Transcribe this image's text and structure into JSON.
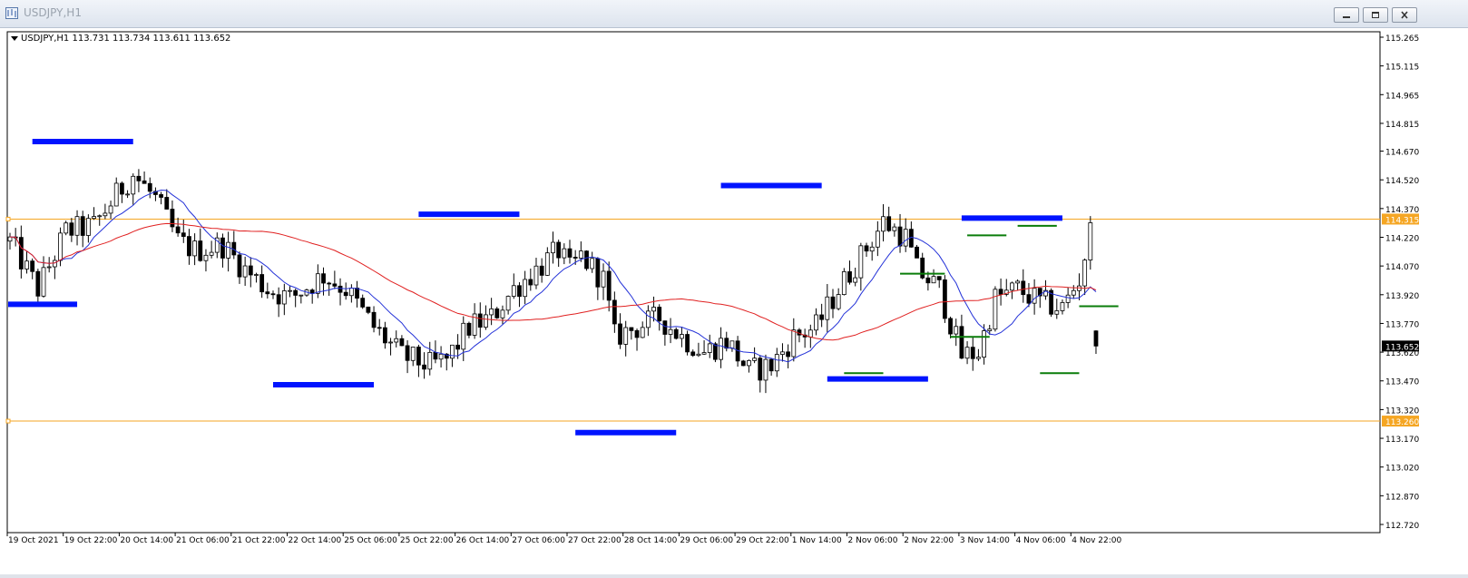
{
  "window": {
    "title": "USDJPY,H1",
    "controls": [
      "minimize-icon",
      "restore-icon",
      "close-icon"
    ]
  },
  "chart_info": {
    "label": "USDJPY,H1  113.731 113.734 113.611 113.652"
  },
  "chart_data": {
    "type": "candlestick",
    "symbol": "USDJPY",
    "timeframe": "H1",
    "ohlc": {
      "open": 113.731,
      "high": 113.734,
      "low": 113.611,
      "close": 113.652
    },
    "ylim": [
      112.72,
      115.265
    ],
    "y_ticks": [
      "115.265",
      "115.115",
      "114.965",
      "114.815",
      "114.670",
      "114.520",
      "114.370",
      "114.220",
      "114.070",
      "113.920",
      "113.770",
      "113.620",
      "113.470",
      "113.320",
      "113.170",
      "113.020",
      "112.870",
      "112.720"
    ],
    "x_ticks": [
      "19 Oct 2021",
      "19 Oct 22:00",
      "20 Oct 14:00",
      "21 Oct 06:00",
      "21 Oct 22:00",
      "22 Oct 14:00",
      "25 Oct 06:00",
      "25 Oct 22:00",
      "26 Oct 14:00",
      "27 Oct 06:00",
      "27 Oct 22:00",
      "28 Oct 14:00",
      "29 Oct 06:00",
      "29 Oct 22:00",
      "1 Nov 14:00",
      "2 Nov 06:00",
      "2 Nov 22:00",
      "3 Nov 14:00",
      "4 Nov 06:00",
      "4 Nov 22:00"
    ],
    "bar_count": 195,
    "anchors": [
      [
        0,
        114.2
      ],
      [
        5,
        113.95
      ],
      [
        10,
        114.25
      ],
      [
        15,
        114.28
      ],
      [
        20,
        114.48
      ],
      [
        22,
        114.55
      ],
      [
        26,
        114.42
      ],
      [
        30,
        114.2
      ],
      [
        33,
        114.15
      ],
      [
        38,
        114.18
      ],
      [
        42,
        114.05
      ],
      [
        46,
        113.95
      ],
      [
        50,
        113.9
      ],
      [
        56,
        114.02
      ],
      [
        60,
        113.95
      ],
      [
        65,
        113.75
      ],
      [
        70,
        113.6
      ],
      [
        75,
        113.55
      ],
      [
        78,
        113.58
      ],
      [
        82,
        113.75
      ],
      [
        86,
        113.8
      ],
      [
        90,
        113.95
      ],
      [
        94,
        114.05
      ],
      [
        98,
        114.15
      ],
      [
        100,
        114.05
      ],
      [
        102,
        114.12
      ],
      [
        106,
        114.0
      ],
      [
        108,
        113.7
      ],
      [
        112,
        113.75
      ],
      [
        116,
        113.8
      ],
      [
        120,
        113.7
      ],
      [
        124,
        113.62
      ],
      [
        128,
        113.68
      ],
      [
        132,
        113.52
      ],
      [
        136,
        113.55
      ],
      [
        140,
        113.7
      ],
      [
        144,
        113.75
      ],
      [
        148,
        113.95
      ],
      [
        152,
        114.12
      ],
      [
        156,
        114.3
      ],
      [
        160,
        114.22
      ],
      [
        162,
        114.05
      ],
      [
        166,
        113.95
      ],
      [
        170,
        113.6
      ],
      [
        173,
        113.62
      ],
      [
        176,
        113.9
      ],
      [
        180,
        113.95
      ],
      [
        184,
        113.88
      ],
      [
        188,
        113.85
      ],
      [
        191,
        114.0
      ],
      [
        193,
        114.25
      ],
      [
        196,
        114.05
      ],
      [
        198,
        114.0
      ],
      [
        200,
        113.85
      ],
      [
        202,
        113.62
      ]
    ],
    "horizontal_levels": [
      {
        "value": 114.315,
        "label": "114.315",
        "color": "#f5a623"
      },
      {
        "value": 113.26,
        "label": "113.260",
        "color": "#f5a623"
      }
    ],
    "current_price": {
      "value": 113.652,
      "label": "113.652"
    },
    "series": [
      {
        "type": "moving-average",
        "color": "#2432d8"
      },
      {
        "type": "moving-average",
        "color": "#e02020"
      }
    ],
    "levels": [
      {
        "bar": [
          4,
          22
        ],
        "value": 114.72,
        "color": "#0014ff"
      },
      {
        "bar": [
          -2,
          12
        ],
        "value": 113.87,
        "color": "#0014ff"
      },
      {
        "bar": [
          47,
          65
        ],
        "value": 113.45,
        "color": "#0014ff"
      },
      {
        "bar": [
          73,
          91
        ],
        "value": 114.34,
        "color": "#0014ff"
      },
      {
        "bar": [
          101,
          119
        ],
        "value": 113.2,
        "color": "#0014ff"
      },
      {
        "bar": [
          127,
          145
        ],
        "value": 114.49,
        "color": "#0014ff"
      },
      {
        "bar": [
          146,
          164
        ],
        "value": 113.48,
        "color": "#0014ff"
      },
      {
        "bar": [
          170,
          188
        ],
        "value": 114.32,
        "color": "#0014ff"
      },
      {
        "bar": [
          149,
          156
        ],
        "value": 113.51,
        "color": "#0a7d0a"
      },
      {
        "bar": [
          159,
          167
        ],
        "value": 114.03,
        "color": "#0a7d0a"
      },
      {
        "bar": [
          168,
          175
        ],
        "value": 113.7,
        "color": "#0a7d0a"
      },
      {
        "bar": [
          171,
          178
        ],
        "value": 114.23,
        "color": "#0a7d0a"
      },
      {
        "bar": [
          180,
          187
        ],
        "value": 114.28,
        "color": "#0a7d0a"
      },
      {
        "bar": [
          184,
          191
        ],
        "value": 113.51,
        "color": "#0a7d0a"
      },
      {
        "bar": [
          191,
          198
        ],
        "value": 113.86,
        "color": "#0a7d0a"
      }
    ],
    "grid": false,
    "legend": "none"
  }
}
